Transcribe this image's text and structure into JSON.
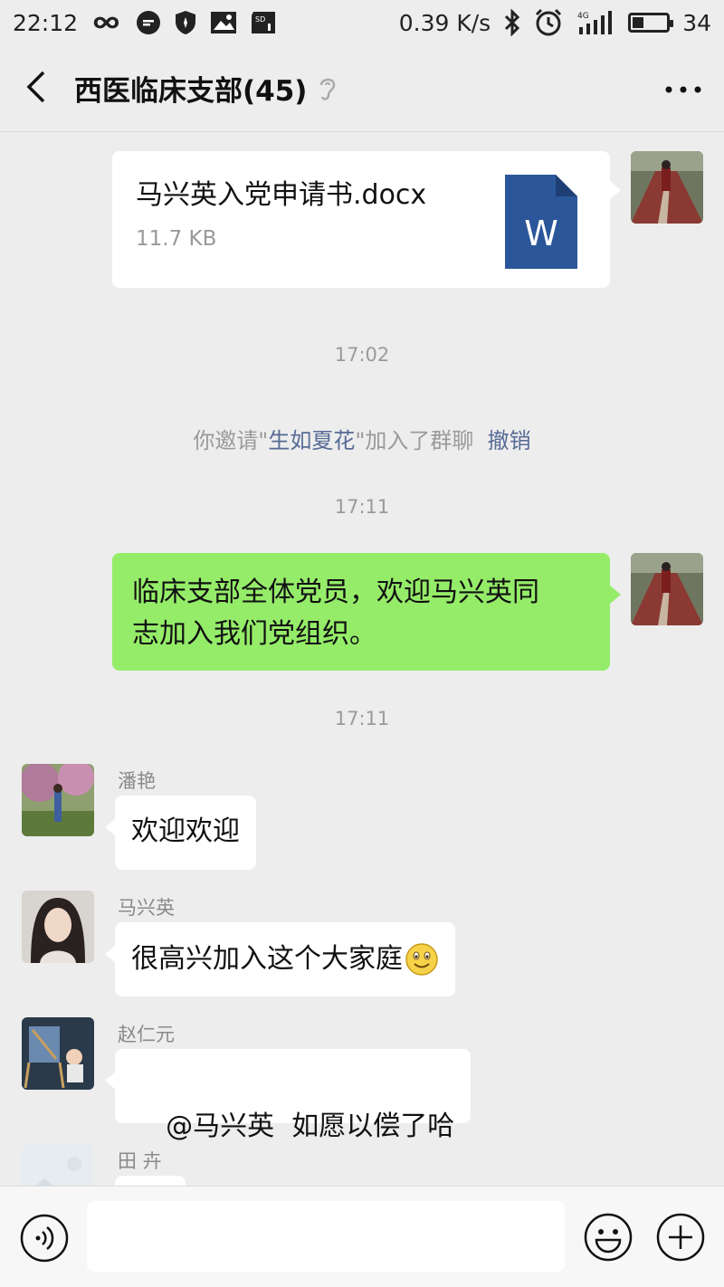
{
  "status_bar": {
    "time": "22:12",
    "network_speed": "0.39 K/s",
    "network_type": "4G",
    "battery": "34",
    "battery_level_percent": 34,
    "icons": [
      "infinity-icon",
      "chat-icon",
      "shield-icon",
      "image-icon",
      "sd-card-icon",
      "bluetooth-icon",
      "alarm-icon",
      "signal-icon",
      "battery-icon"
    ]
  },
  "header": {
    "title": "西医临床支部(45)",
    "back_icon": "chevron-left-icon",
    "muted_icon": "ear-icon",
    "more_icon": "more-icon"
  },
  "messages": {
    "file": {
      "name": "马兴英入党申请书.docx",
      "size": "11.7 KB",
      "icon_letter": "W"
    },
    "time1": "17:02",
    "system": {
      "prefix": "你邀请\"",
      "invitee": "生如夏花",
      "suffix": "\"加入了群聊",
      "revoke": "撤销"
    },
    "time2": "17:11",
    "own_text_line1": "临床支部全体党员，欢迎马兴英同",
    "own_text_line2": "志加入我们党组织。",
    "time3": "17:11",
    "m1": {
      "sender": "潘艳",
      "text": "欢迎欢迎"
    },
    "m2": {
      "sender": "马兴英",
      "text": "很高兴加入这个大家庭"
    },
    "m3": {
      "sender": "赵仁元",
      "text": "@马兴英  如愿以偿了哈"
    },
    "m4": {
      "sender": "田 卉"
    }
  },
  "input_bar": {
    "placeholder": ""
  },
  "colors": {
    "background": "#ededed",
    "own_bubble": "#95ec69",
    "link": "#576b95",
    "word_blue": "#2b579a"
  }
}
